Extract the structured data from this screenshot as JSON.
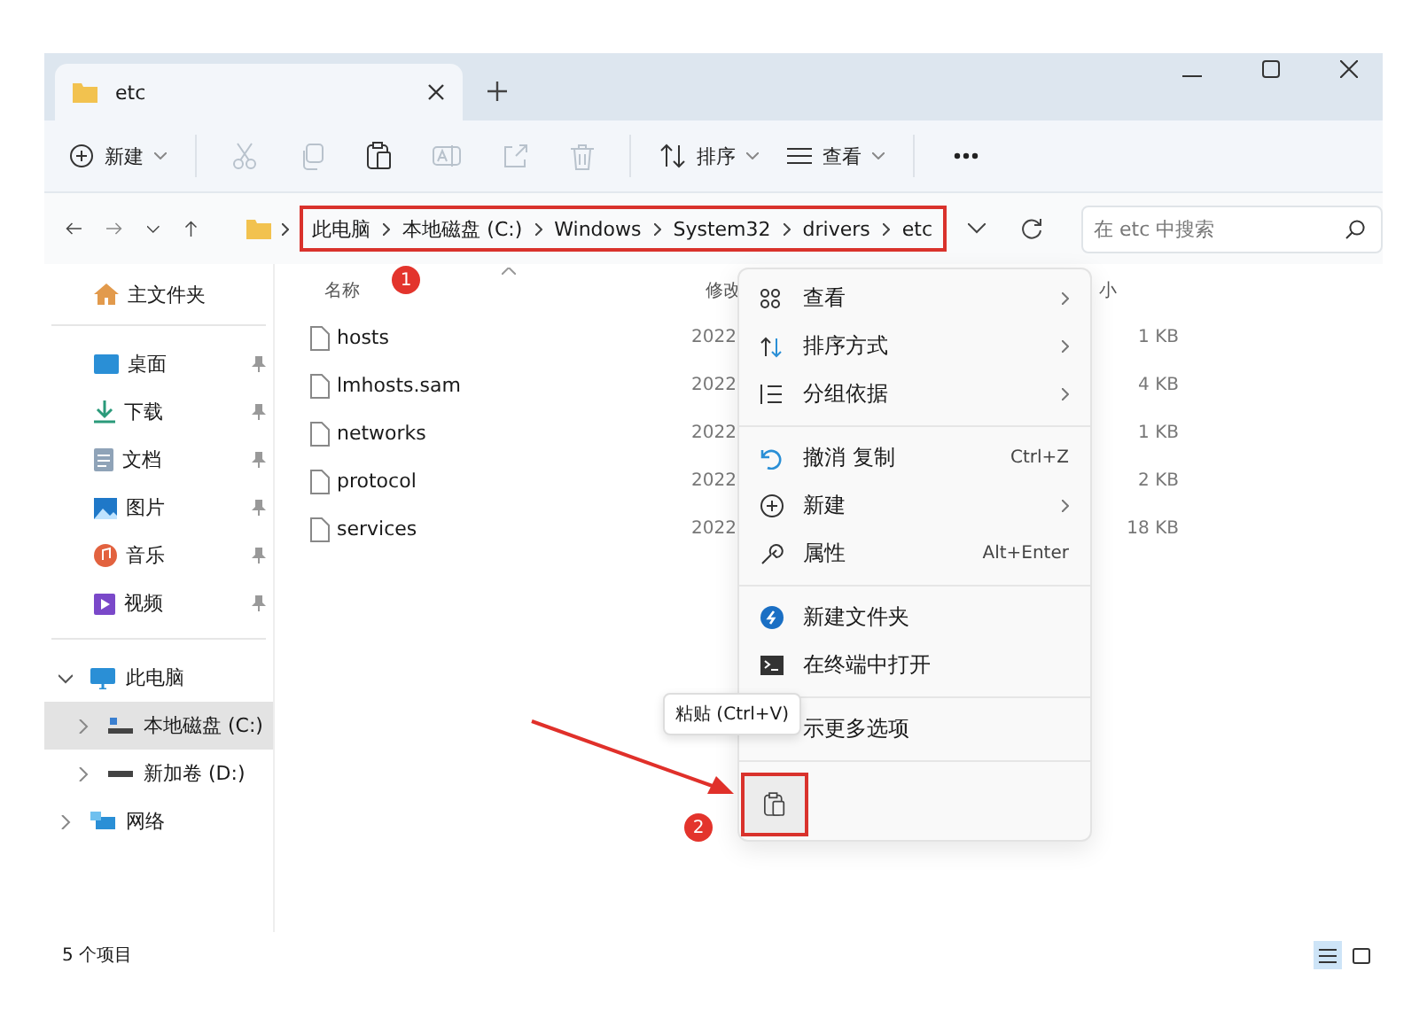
{
  "tabs": [
    {
      "title": "etc",
      "selected": true
    }
  ],
  "toolbar": {
    "new_button": "新建",
    "actions": [
      {
        "kind": "cut",
        "disabled": true
      },
      {
        "kind": "copy",
        "disabled": true
      },
      {
        "kind": "paste",
        "disabled": false
      },
      {
        "kind": "rename",
        "disabled": true
      },
      {
        "kind": "share",
        "disabled": true
      },
      {
        "kind": "delete",
        "disabled": true
      }
    ],
    "sort_button": "排序",
    "view_button": "查看"
  },
  "address": {
    "breadcrumbs": [
      "此电脑",
      "本地磁盘 (C:)",
      "Windows",
      "System32",
      "drivers",
      "etc"
    ],
    "search_placeholder": "在 etc 中搜索"
  },
  "sidebar": {
    "home": "主文件夹",
    "quick_access": [
      {
        "kind": "desktop",
        "label": "桌面",
        "pinned": true
      },
      {
        "kind": "downloads",
        "label": "下载",
        "pinned": true
      },
      {
        "kind": "documents",
        "label": "文档",
        "pinned": true
      },
      {
        "kind": "pictures",
        "label": "图片",
        "pinned": true
      },
      {
        "kind": "music",
        "label": "音乐",
        "pinned": true
      },
      {
        "kind": "videos",
        "label": "视频",
        "pinned": true
      }
    ],
    "tree": [
      {
        "kind": "pc",
        "label": "此电脑",
        "expanded": true,
        "selected": false,
        "children": [
          {
            "kind": "drive-c",
            "label": "本地磁盘 (C:)",
            "expanded": false,
            "selected": true
          },
          {
            "kind": "drive",
            "label": "新加卷 (D:)",
            "expanded": false,
            "selected": false
          }
        ]
      },
      {
        "kind": "network",
        "label": "网络",
        "expanded": false,
        "selected": false
      }
    ]
  },
  "file_list": {
    "columns": [
      "名称",
      "修改",
      "小"
    ],
    "rows": [
      {
        "name": "hosts",
        "modified": "2022",
        "size": "1 KB"
      },
      {
        "name": "lmhosts.sam",
        "modified": "2022",
        "size": "4 KB"
      },
      {
        "name": "networks",
        "modified": "2022",
        "size": "1 KB"
      },
      {
        "name": "protocol",
        "modified": "2022",
        "size": "2 KB"
      },
      {
        "name": "services",
        "modified": "2022",
        "size": "18 KB"
      }
    ]
  },
  "context_menu": {
    "groups": [
      [
        {
          "kind": "view",
          "label": "查看",
          "submenu": true
        },
        {
          "kind": "sort",
          "label": "排序方式",
          "submenu": true
        },
        {
          "kind": "group",
          "label": "分组依据",
          "submenu": true
        }
      ],
      [
        {
          "kind": "undo",
          "label": "撤消 复制",
          "shortcut": "Ctrl+Z",
          "submenu": false
        },
        {
          "kind": "new",
          "label": "新建",
          "submenu": true
        },
        {
          "kind": "properties",
          "label": "属性",
          "shortcut": "Alt+Enter",
          "submenu": false
        }
      ],
      [
        {
          "kind": "new-folder",
          "label": "新建文件夹",
          "submenu": false
        },
        {
          "kind": "terminal",
          "label": "在终端中打开",
          "submenu": false
        }
      ],
      [
        {
          "kind": "more",
          "label": "示更多选项",
          "submenu": false
        }
      ]
    ],
    "paste_tooltip": "粘贴 (Ctrl+V)"
  },
  "annotations": [
    {
      "label": "1"
    },
    {
      "label": "2"
    }
  ],
  "status_bar": {
    "item_count": "5 个项目",
    "view_modes": [
      {
        "kind": "details",
        "selected": true
      },
      {
        "kind": "tiles",
        "selected": false
      }
    ]
  }
}
